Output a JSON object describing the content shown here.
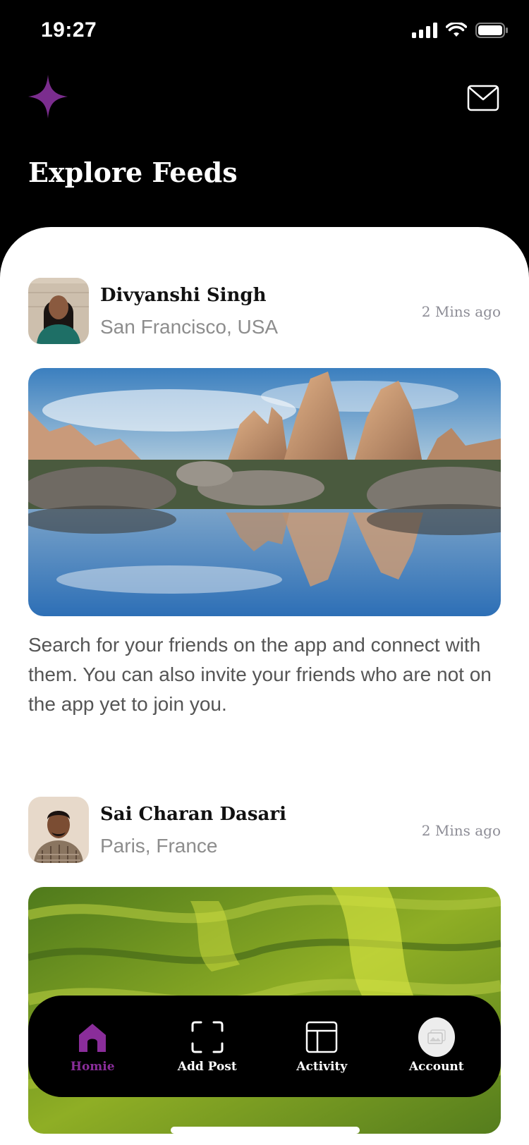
{
  "status_bar": {
    "time": "19:27",
    "signal_icon": "cellular-signal-icon",
    "wifi_icon": "wifi-icon",
    "battery_icon": "battery-icon"
  },
  "header": {
    "logo_icon": "sparkle-star-icon",
    "mail_icon": "envelope-icon",
    "title": "Explore Feeds",
    "logo_color": "#7b2d8e"
  },
  "feed": {
    "posts": [
      {
        "author": "Divyanshi Singh",
        "location": "San Francisco, USA",
        "time": "2 Mins ago",
        "caption": "Search for your friends on the app and connect with them. You can also invite your friends who are not on the app yet to join you."
      },
      {
        "author": "Sai Charan Dasari",
        "location": "Paris, France",
        "time": "2 Mins ago",
        "caption": ""
      }
    ]
  },
  "nav": {
    "items": [
      {
        "label": "Homie",
        "icon": "home-icon",
        "active": true
      },
      {
        "label": "Add Post",
        "icon": "add-post-frame-icon",
        "active": false
      },
      {
        "label": "Activity",
        "icon": "activity-layout-icon",
        "active": false
      },
      {
        "label": "Account",
        "icon": "account-image-icon",
        "active": false
      }
    ],
    "active_color": "#8a2d9a"
  }
}
